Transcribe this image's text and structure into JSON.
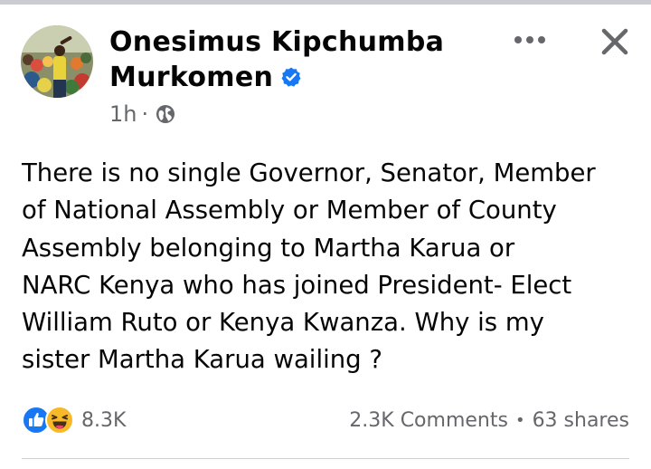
{
  "post": {
    "author_line1": "Onesimus Kipchumba",
    "author_line2": "Murkomen",
    "timestamp": "1h",
    "separator": "·",
    "privacy_icon": "globe-icon",
    "verified_icon": "verified-badge-icon",
    "body": "There is no single Governor, Senator, Member\nof National Assembly or Member of County\nAssembly belonging to Martha Karua or\nNARC Kenya who has joined President- Elect\nWilliam Ruto or Kenya Kwanza. Why is my\nsister Martha Karua wailing ?",
    "reaction_icons": [
      "like-icon",
      "haha-icon"
    ],
    "reactions_count": "8.3K",
    "comments": "2.3K Comments",
    "bullet": "•",
    "shares": "63 shares"
  },
  "header_actions": {
    "more_icon": "more-options-icon",
    "close_icon": "close-icon"
  },
  "colors": {
    "text": "#050505",
    "secondary": "#65676b",
    "accent_blue": "#1877f2",
    "haha_yellow": "#f7b928",
    "divider": "#ced0d4"
  }
}
